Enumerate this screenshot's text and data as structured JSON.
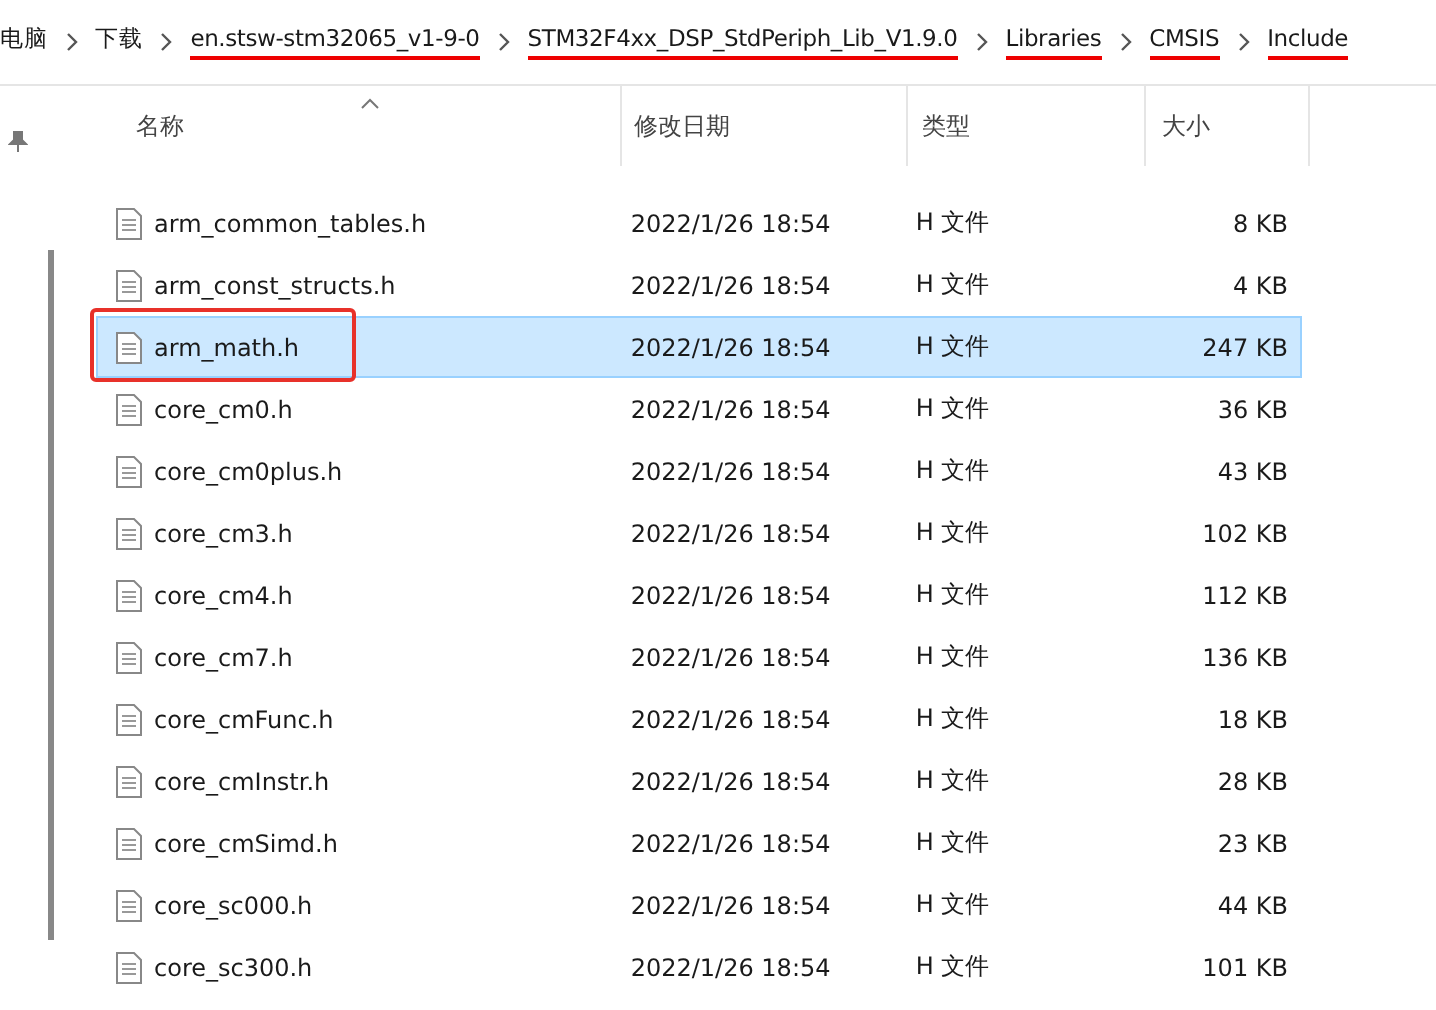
{
  "breadcrumb": [
    {
      "label": "电脑",
      "underlined": false
    },
    {
      "label": "下载",
      "underlined": false
    },
    {
      "label": "en.stsw-stm32065_v1-9-0",
      "underlined": true
    },
    {
      "label": "STM32F4xx_DSP_StdPeriph_Lib_V1.9.0",
      "underlined": true
    },
    {
      "label": "Libraries",
      "underlined": true
    },
    {
      "label": "CMSIS",
      "underlined": true
    },
    {
      "label": "Include",
      "underlined": true
    }
  ],
  "columns": [
    "名称",
    "修改日期",
    "类型",
    "大小"
  ],
  "rows": [
    {
      "name": "arm_common_tables.h",
      "date": "2022/1/26 18:54",
      "type": "H 文件",
      "size": "8 KB",
      "selected": false,
      "annotated": false
    },
    {
      "name": "arm_const_structs.h",
      "date": "2022/1/26 18:54",
      "type": "H 文件",
      "size": "4 KB",
      "selected": false,
      "annotated": false
    },
    {
      "name": "arm_math.h",
      "date": "2022/1/26 18:54",
      "type": "H 文件",
      "size": "247 KB",
      "selected": true,
      "annotated": true
    },
    {
      "name": "core_cm0.h",
      "date": "2022/1/26 18:54",
      "type": "H 文件",
      "size": "36 KB",
      "selected": false,
      "annotated": false
    },
    {
      "name": "core_cm0plus.h",
      "date": "2022/1/26 18:54",
      "type": "H 文件",
      "size": "43 KB",
      "selected": false,
      "annotated": false
    },
    {
      "name": "core_cm3.h",
      "date": "2022/1/26 18:54",
      "type": "H 文件",
      "size": "102 KB",
      "selected": false,
      "annotated": false
    },
    {
      "name": "core_cm4.h",
      "date": "2022/1/26 18:54",
      "type": "H 文件",
      "size": "112 KB",
      "selected": false,
      "annotated": false
    },
    {
      "name": "core_cm7.h",
      "date": "2022/1/26 18:54",
      "type": "H 文件",
      "size": "136 KB",
      "selected": false,
      "annotated": false
    },
    {
      "name": "core_cmFunc.h",
      "date": "2022/1/26 18:54",
      "type": "H 文件",
      "size": "18 KB",
      "selected": false,
      "annotated": false
    },
    {
      "name": "core_cmInstr.h",
      "date": "2022/1/26 18:54",
      "type": "H 文件",
      "size": "28 KB",
      "selected": false,
      "annotated": false
    },
    {
      "name": "core_cmSimd.h",
      "date": "2022/1/26 18:54",
      "type": "H 文件",
      "size": "23 KB",
      "selected": false,
      "annotated": false
    },
    {
      "name": "core_sc000.h",
      "date": "2022/1/26 18:54",
      "type": "H 文件",
      "size": "44 KB",
      "selected": false,
      "annotated": false
    },
    {
      "name": "core_sc300.h",
      "date": "2022/1/26 18:54",
      "type": "H 文件",
      "size": "101 KB",
      "selected": false,
      "annotated": false
    }
  ]
}
